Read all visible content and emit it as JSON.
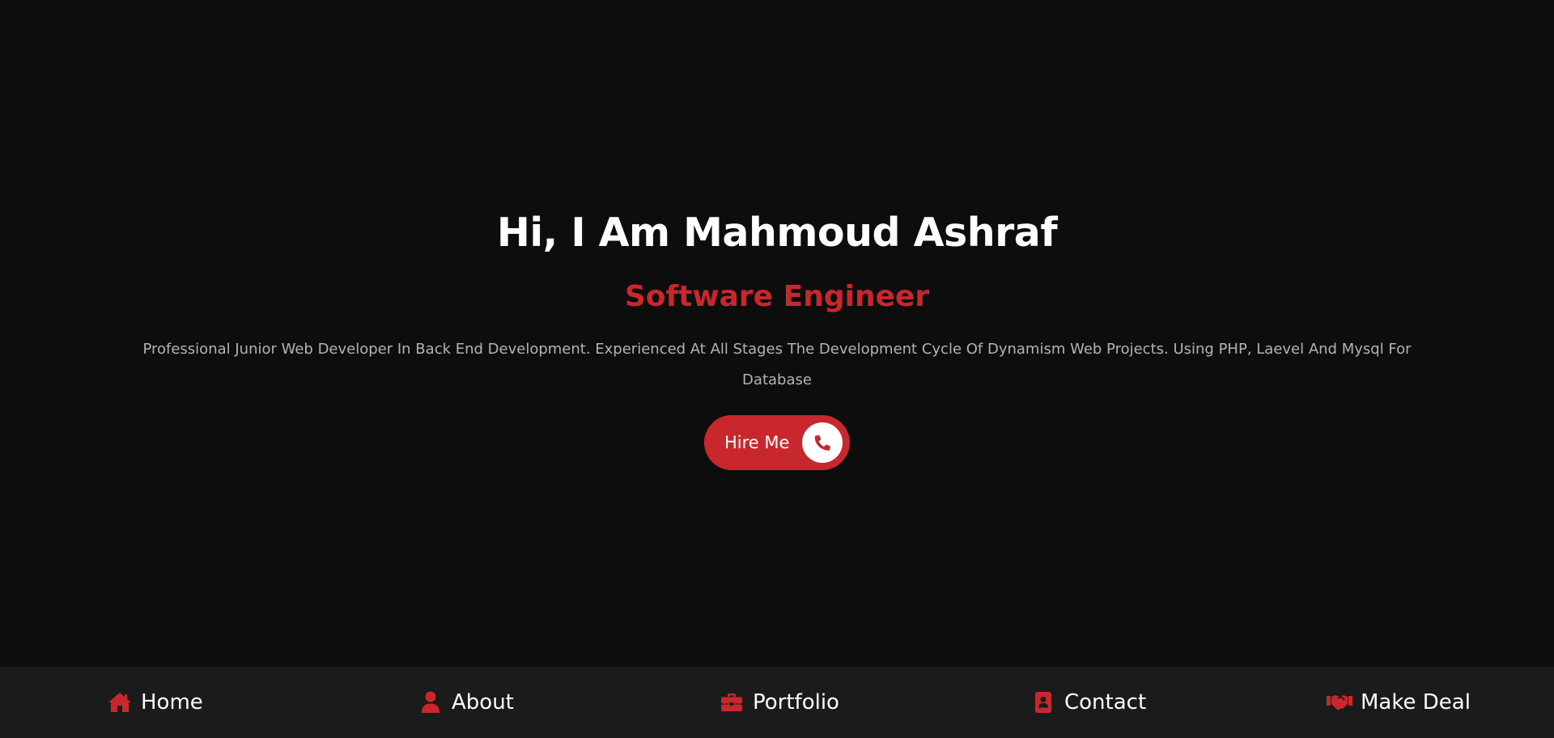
{
  "hero": {
    "title": "Hi, I Am Mahmoud Ashraf",
    "role": "Software Engineer",
    "description": "Professional Junior Web Developer In Back End Development. Experienced At All Stages The Development Cycle Of Dynamism Web Projects. Using PHP, Laevel And Mysql For Database",
    "cta": {
      "label": "Hire Me",
      "icon": "phone-icon"
    }
  },
  "nav": {
    "items": [
      {
        "label": "Home",
        "icon": "home-icon"
      },
      {
        "label": "About",
        "icon": "user-icon"
      },
      {
        "label": "Portfolio",
        "icon": "briefcase-icon"
      },
      {
        "label": "Contact",
        "icon": "contact-book-icon"
      },
      {
        "label": "Make Deal",
        "icon": "handshake-icon"
      }
    ]
  },
  "colors": {
    "background": "#0d0d0d",
    "nav_background": "#1b1b1b",
    "accent": "#c8282d",
    "text_primary": "#ffffff",
    "text_muted": "#b3b3b3"
  }
}
